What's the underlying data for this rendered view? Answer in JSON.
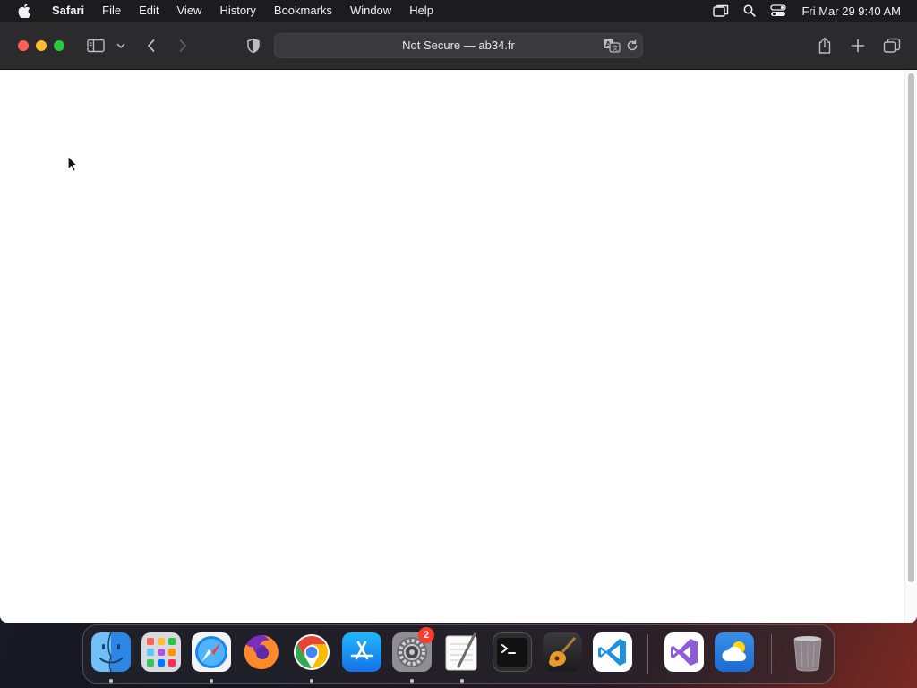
{
  "menubar": {
    "app_name": "Safari",
    "items": [
      "File",
      "Edit",
      "View",
      "History",
      "Bookmarks",
      "Window",
      "Help"
    ],
    "clock": "Fri Mar 29  9:40 AM"
  },
  "browser": {
    "address_text": "Not Secure — ab34.fr"
  },
  "dock": {
    "notification_badge": "2",
    "apps": [
      "finder",
      "launchpad",
      "safari",
      "firefox",
      "chrome",
      "app-store",
      "system-settings",
      "textedit",
      "terminal",
      "garageband",
      "vscode",
      "visual-studio",
      "weather",
      "trash"
    ]
  },
  "colors": {
    "close": "#ff5f57",
    "minimize": "#febc2e",
    "maximize": "#28c840",
    "badge": "#ff3b30"
  }
}
